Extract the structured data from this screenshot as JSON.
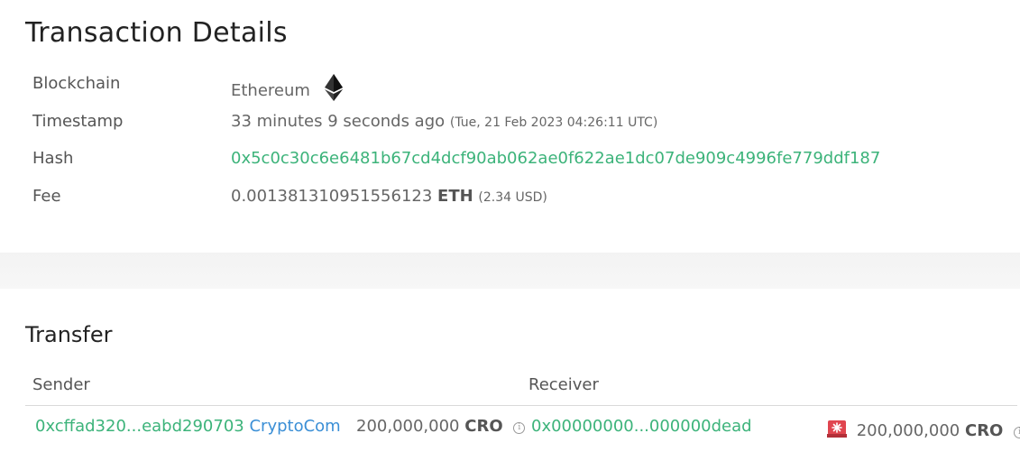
{
  "details": {
    "title": "Transaction Details",
    "rows": {
      "blockchain": {
        "label": "Blockchain",
        "value": "Ethereum",
        "icon": "ethereum-icon"
      },
      "timestamp": {
        "label": "Timestamp",
        "relative": "33 minutes 9 seconds ago",
        "absolute": "(Tue, 21 Feb 2023 04:26:11 UTC)"
      },
      "hash": {
        "label": "Hash",
        "value": "0x5c0c30c6e6481b67cd4dcf90ab062ae0f622ae1dc07de909c4996fe779ddf187"
      },
      "fee": {
        "label": "Fee",
        "amount": "0.001381310951556123",
        "unit": "ETH",
        "usd": "(2.34 USD)"
      }
    }
  },
  "transfer": {
    "title": "Transfer",
    "columns": {
      "sender": "Sender",
      "receiver": "Receiver"
    },
    "row": {
      "sender_address": "0xcffad320...eabd290703",
      "sender_name": "CryptoCom",
      "sent_amount": "200,000,000",
      "sent_unit": "CRO",
      "receiver_address": "0x00000000...000000dead",
      "received_amount": "200,000,000",
      "received_unit": "CRO"
    }
  },
  "colors": {
    "link_green": "#3cb37a",
    "link_blue": "#3b8fd6",
    "alert_red": "#e0454f"
  }
}
